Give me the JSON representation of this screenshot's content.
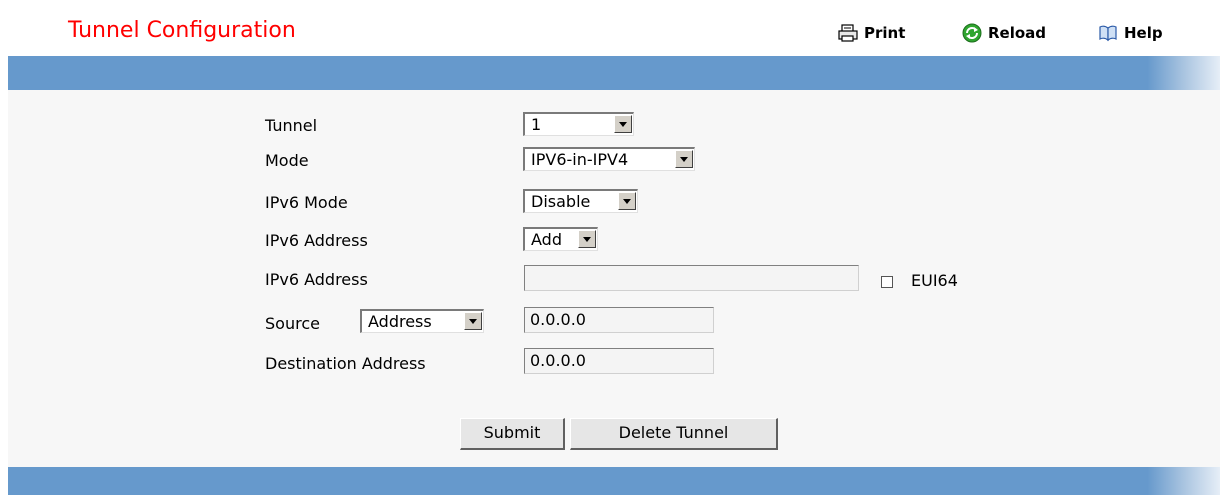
{
  "header": {
    "title": "Tunnel Configuration",
    "print_label": "Print",
    "reload_label": "Reload",
    "help_label": "Help"
  },
  "colors": {
    "title": "#ff0000",
    "band": "#6699cc",
    "form_bg": "#f7f7f7"
  },
  "form": {
    "tunnel_label": "Tunnel",
    "tunnel_value": "1",
    "mode_label": "Mode",
    "mode_value": "IPV6-in-IPV4",
    "ipv6_mode_label": "IPv6 Mode",
    "ipv6_mode_value": "Disable",
    "ipv6_address_action_label": "IPv6 Address",
    "ipv6_address_action_value": "Add",
    "ipv6_address_label": "IPv6 Address",
    "ipv6_address_value": "",
    "eui64_label": "EUI64",
    "eui64_checked": false,
    "source_label": "Source",
    "source_type_value": "Address",
    "source_address_value": "0.0.0.0",
    "destination_label": "Destination Address",
    "destination_value": "0.0.0.0"
  },
  "actions": {
    "submit_label": "Submit",
    "delete_label": "Delete Tunnel"
  },
  "icons": {
    "print": "printer-icon",
    "reload": "reload-icon",
    "help": "book-icon"
  }
}
